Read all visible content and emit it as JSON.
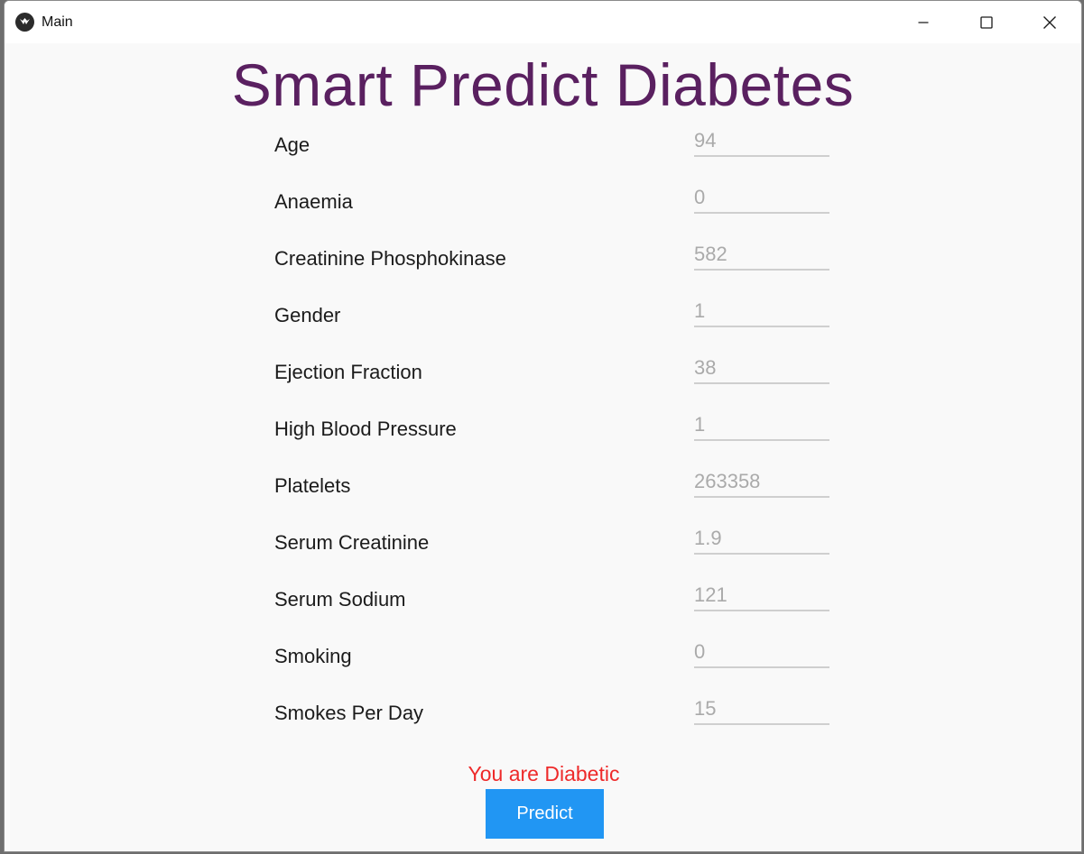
{
  "window": {
    "title": "Main"
  },
  "app": {
    "heading": "Smart Predict Diabetes",
    "fields": [
      {
        "label": "Age",
        "value": "94"
      },
      {
        "label": "Anaemia",
        "value": "0"
      },
      {
        "label": "Creatinine Phosphokinase",
        "value": "582"
      },
      {
        "label": "Gender",
        "value": "1"
      },
      {
        "label": "Ejection Fraction",
        "value": "38"
      },
      {
        "label": "High Blood Pressure",
        "value": "1"
      },
      {
        "label": "Platelets",
        "value": "263358"
      },
      {
        "label": "Serum Creatinine",
        "value": "1.9"
      },
      {
        "label": "Serum Sodium",
        "value": "121"
      },
      {
        "label": "Smoking",
        "value": "0"
      },
      {
        "label": "Smokes Per Day",
        "value": "15"
      }
    ],
    "result_text": "You are Diabetic",
    "predict_label": "Predict"
  },
  "colors": {
    "heading": "#5a2060",
    "result": "#ee2a2a",
    "button": "#2196f3"
  },
  "icons": {
    "app": "kivy-logo-icon",
    "minimize": "minimize-icon",
    "maximize": "maximize-icon",
    "close": "close-icon"
  }
}
